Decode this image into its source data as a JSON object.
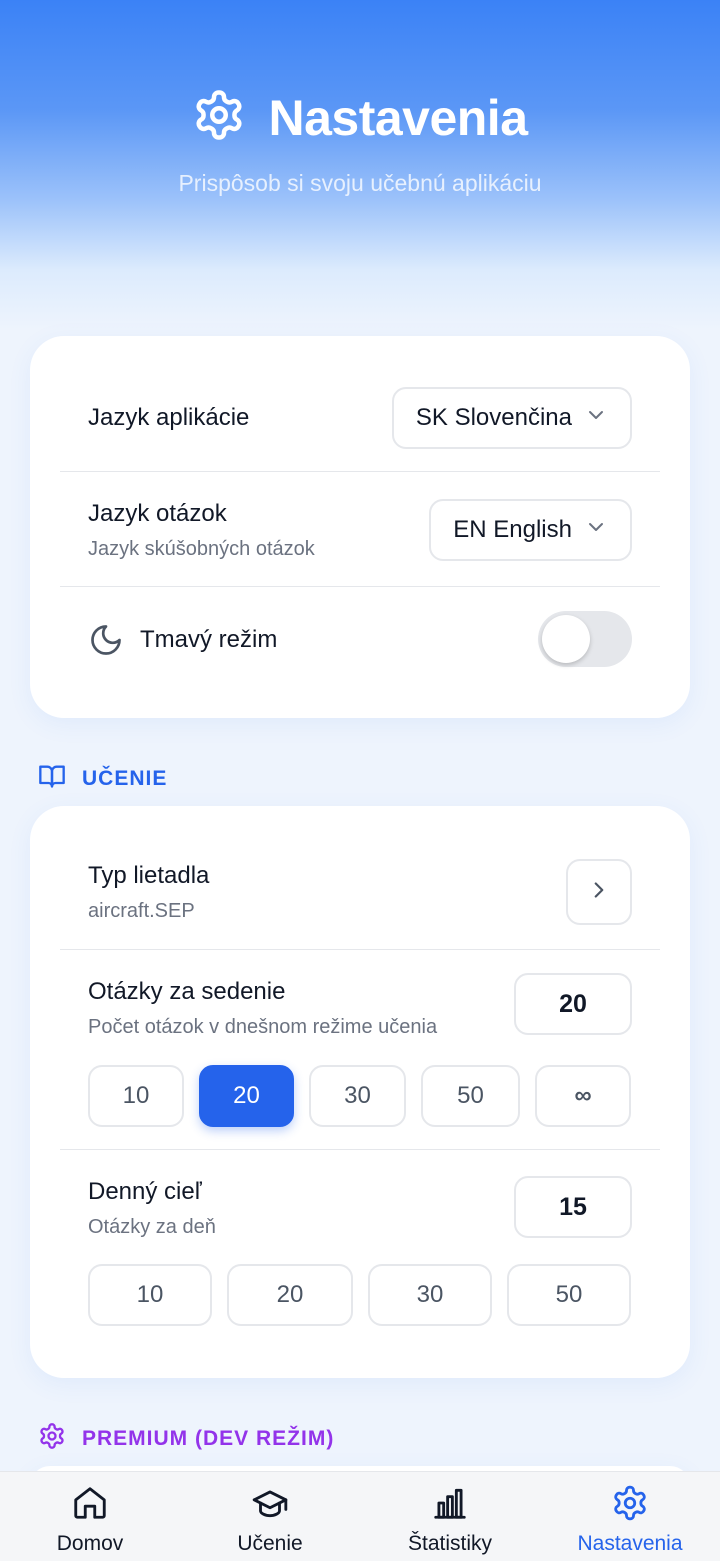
{
  "header": {
    "title": "Nastavenia",
    "subtitle": "Prispôsob si svoju učebnú aplikáciu",
    "icon": "gear-icon"
  },
  "general": {
    "app_language": {
      "label": "Jazyk aplikácie",
      "value": "SK Slovenčina"
    },
    "question_language": {
      "label": "Jazyk otázok",
      "sublabel": "Jazyk skúšobných otázok",
      "value": "EN English"
    },
    "dark_mode": {
      "label": "Tmavý režim",
      "enabled": false,
      "icon": "moon-icon"
    }
  },
  "learning": {
    "section_title": "UČENIE",
    "section_icon": "book-open-icon",
    "accent": "#2563eb",
    "aircraft": {
      "label": "Typ lietadla",
      "sublabel": "aircraft.SEP"
    },
    "questions_per_session": {
      "label": "Otázky za sedenie",
      "sublabel": "Počet otázok v dnešnom režime učenia",
      "value": "20",
      "options": [
        "10",
        "20",
        "30",
        "50",
        "∞"
      ],
      "selected": "20"
    },
    "daily_goal": {
      "label": "Denný cieľ",
      "sublabel": "Otázky za deň",
      "value": "15",
      "options": [
        "10",
        "20",
        "30",
        "50"
      ]
    }
  },
  "premium": {
    "section_title": "PREMIUM (DEV REŽIM)",
    "section_icon": "gear-icon",
    "accent": "#9333ea"
  },
  "bottom_nav": {
    "items": [
      {
        "label": "Domov",
        "icon": "home-icon"
      },
      {
        "label": "Učenie",
        "icon": "graduation-cap-icon"
      },
      {
        "label": "Štatistiky",
        "icon": "bar-chart-icon"
      },
      {
        "label": "Nastavenia",
        "icon": "gear-icon",
        "active": true
      }
    ]
  }
}
